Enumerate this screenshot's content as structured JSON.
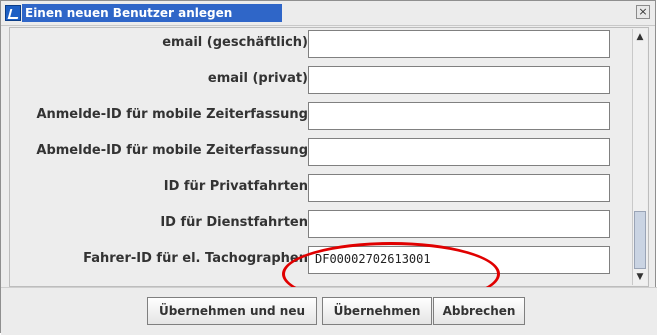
{
  "window": {
    "title": "Einen neuen Benutzer anlegen",
    "close_symbol": "×",
    "app_icon": "V-icon"
  },
  "form": {
    "fields": [
      {
        "label": "email (geschäftlich)",
        "value": ""
      },
      {
        "label": "email (privat)",
        "value": ""
      },
      {
        "label": "Anmelde-ID für mobile Zeiterfassung",
        "value": ""
      },
      {
        "label": "Abmelde-ID für mobile Zeiterfassung",
        "value": ""
      },
      {
        "label": "ID für Privatfahrten",
        "value": ""
      },
      {
        "label": "ID für Dienstfahrten",
        "value": ""
      },
      {
        "label": "Fahrer-ID für el. Tachographen",
        "value": "DF00002702613001"
      }
    ]
  },
  "buttons": {
    "apply_new": "Übernehmen und neu",
    "apply": "Übernehmen",
    "cancel": "Abbrechen"
  },
  "scrollbar": {
    "up": "▲",
    "down": "▼"
  },
  "annotation": {
    "color": "#e00000"
  }
}
